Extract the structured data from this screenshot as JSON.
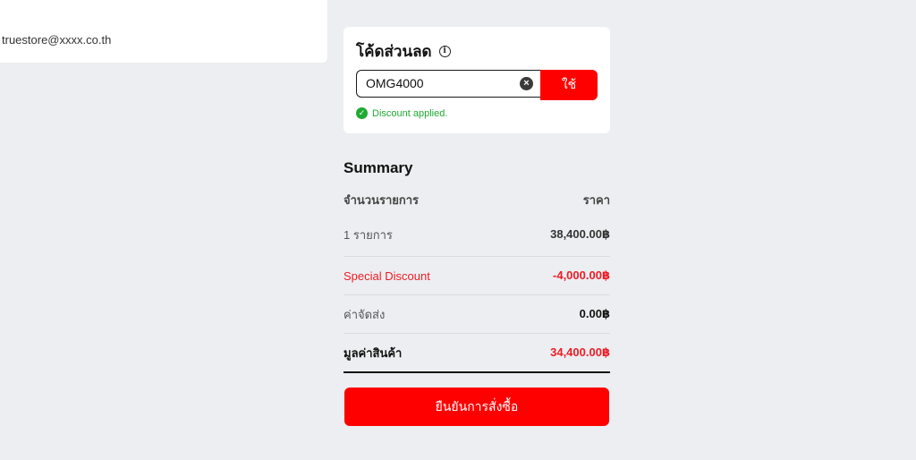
{
  "account": {
    "email": "truestore@xxxx.co.th"
  },
  "coupon": {
    "title": "โค้ดส่วนลด",
    "info_icon": "info-icon",
    "code_value": "OMG4000",
    "clear_icon": "clear-icon",
    "apply_label": "ใช้",
    "status_icon": "check-circle-icon",
    "status_text": "Discount applied."
  },
  "summary": {
    "title": "Summary",
    "header": {
      "label": "จำนวนรายการ",
      "value": "ราคา"
    },
    "rows": [
      {
        "label": "1 รายการ",
        "value": "38,400.00฿"
      },
      {
        "label": "Special Discount",
        "value": "-4,000.00฿"
      },
      {
        "label": "ค่าจัดส่ง",
        "value": "0.00฿"
      }
    ],
    "total": {
      "label": "มูลค่าสินค้า",
      "value": "34,400.00฿"
    }
  },
  "confirm_label": "ยืนยันการสั่งซื้อ",
  "colors": {
    "accent": "#ff0000",
    "discount": "#ee1c25",
    "success": "#1faa34",
    "background": "#eceef1"
  }
}
